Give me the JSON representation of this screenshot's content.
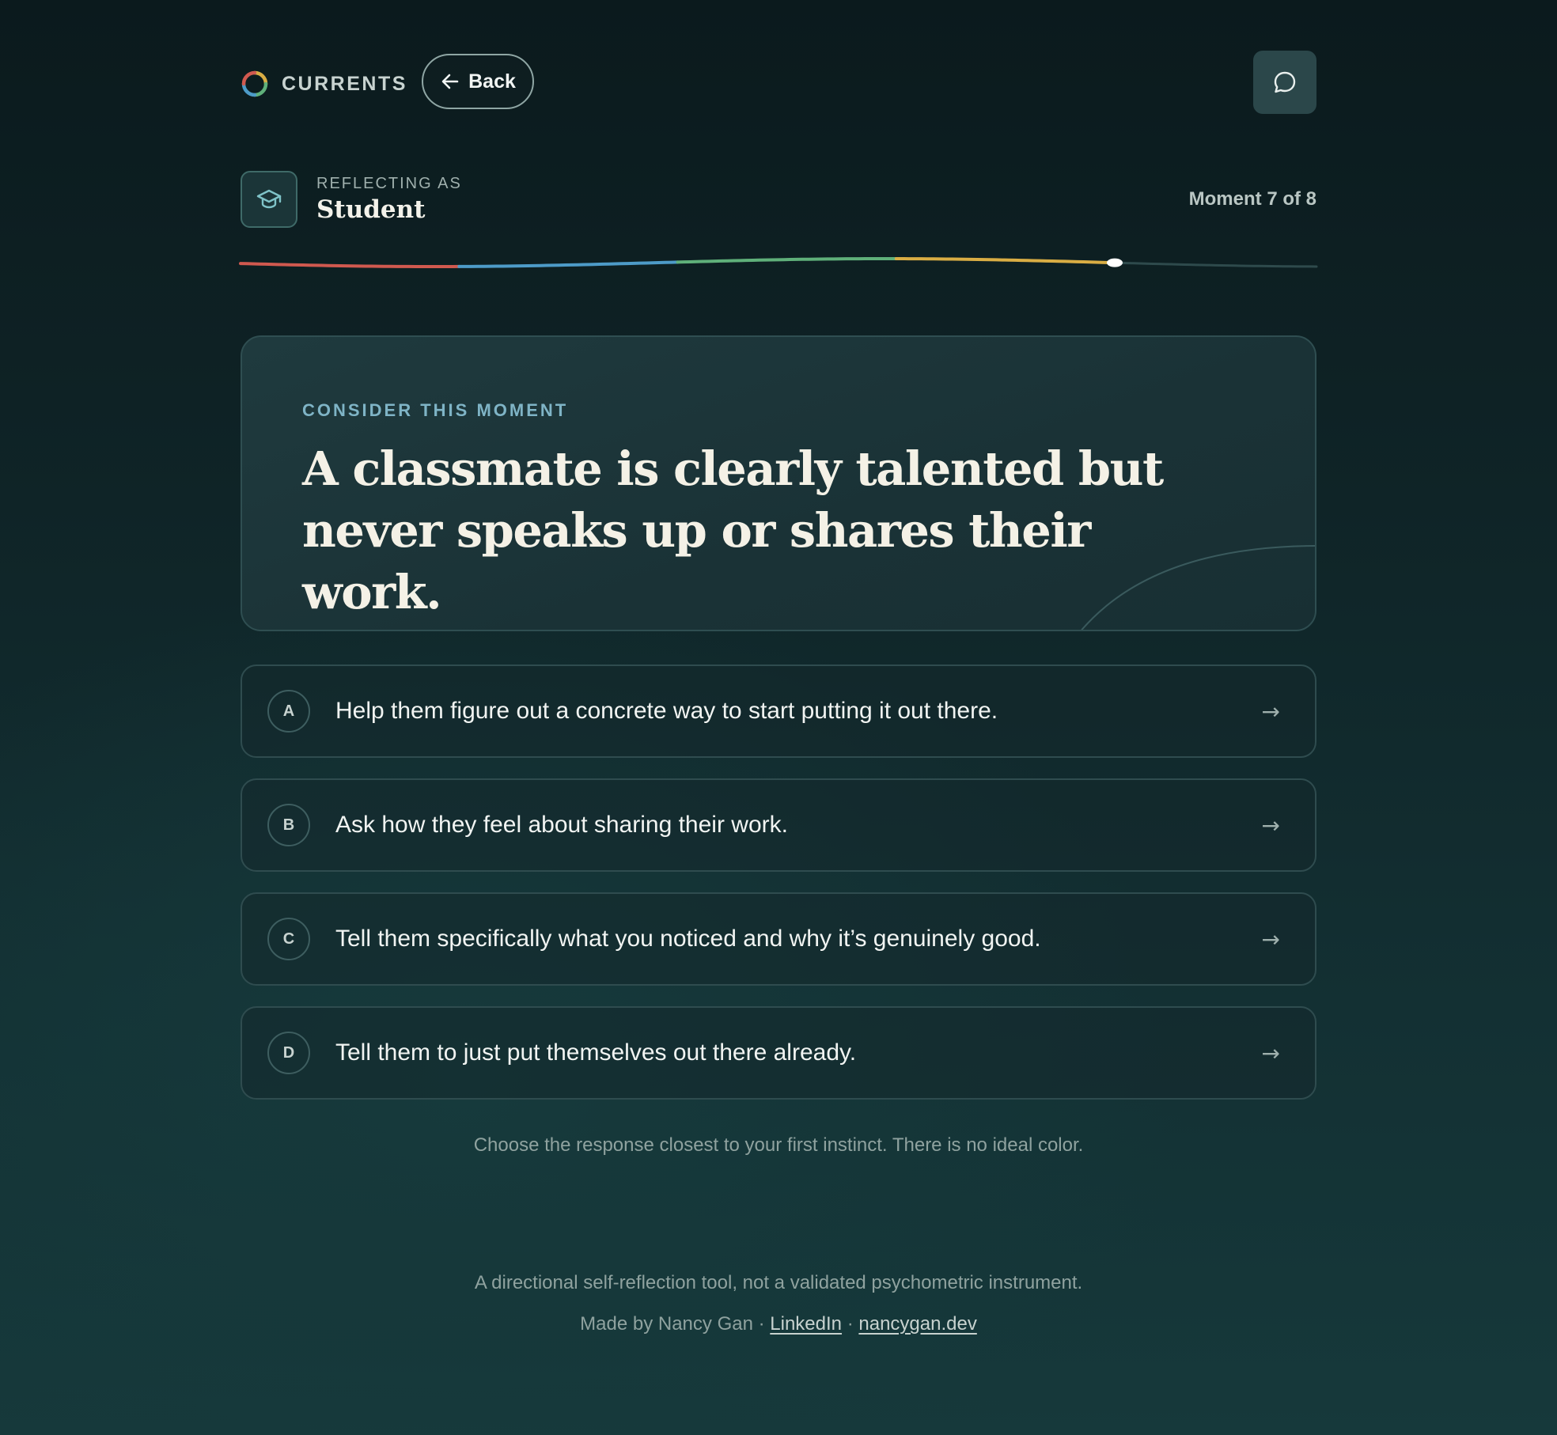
{
  "header": {
    "brand_name": "CURRENTS",
    "back_label": "Back",
    "chat_icon": "chat-bubble-icon"
  },
  "persona": {
    "kicker": "REFLECTING AS",
    "role": "Student",
    "icon": "graduation-cap-icon"
  },
  "progress": {
    "label": "Moment 7 of 8",
    "current": 7,
    "total": 8,
    "segment_colors": [
      "#d0594f",
      "#4d9bc8",
      "#5fb07a",
      "#d9ad44",
      "#2e4a4c"
    ],
    "marker_color": "#ffffff"
  },
  "prompt": {
    "kicker": "CONSIDER THIS MOMENT",
    "question": "A classmate is clearly talented but never speaks up or shares their work."
  },
  "options": [
    {
      "letter": "A",
      "text": "Help them figure out a concrete way to start putting it out there.",
      "arrow": "→"
    },
    {
      "letter": "B",
      "text": "Ask how they feel about sharing their work.",
      "arrow": "→"
    },
    {
      "letter": "C",
      "text": "Tell them specifically what you noticed and why it’s genuinely good.",
      "arrow": "→"
    },
    {
      "letter": "D",
      "text": "Tell them to just put themselves out there already.",
      "arrow": "→"
    }
  ],
  "hint": "Choose the response closest to your first instinct. There is no ideal color.",
  "footer": {
    "disclaimer": "A directional self-reflection tool, not a validated psychometric instrument.",
    "made_by": "Made by Nancy Gan",
    "separator": "·",
    "links": [
      {
        "label": "LinkedIn"
      },
      {
        "label": "nancygan.dev"
      }
    ]
  },
  "colors": {
    "accent": "#7fb4c6",
    "background": "#0f2427"
  }
}
